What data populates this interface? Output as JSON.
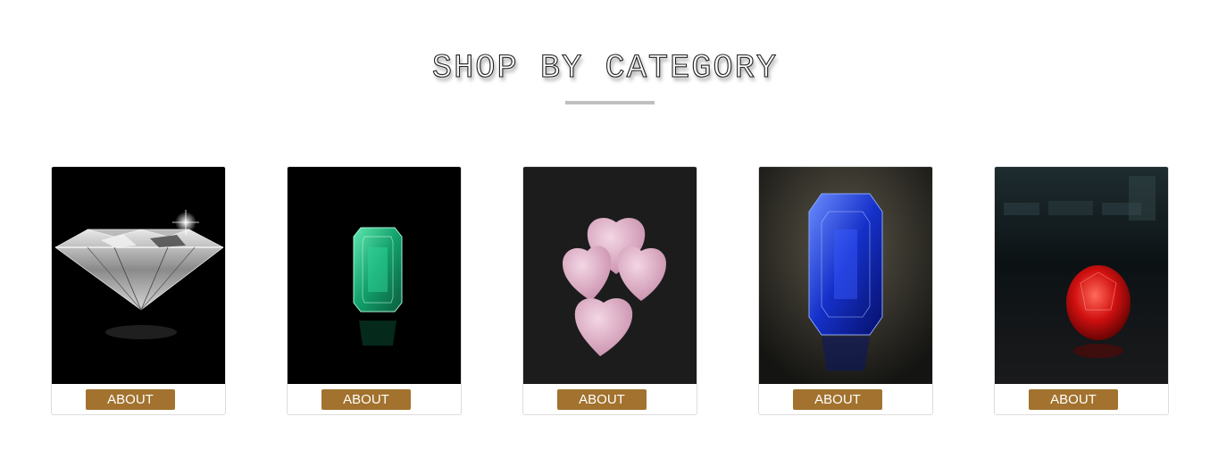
{
  "section": {
    "title": "SHOP BY CATEGORY"
  },
  "categories": [
    {
      "image_icon": "diamond-icon",
      "button_label": "ABOUT"
    },
    {
      "image_icon": "emerald-icon",
      "button_label": "ABOUT"
    },
    {
      "image_icon": "rose-quartz-hearts-icon",
      "button_label": "ABOUT"
    },
    {
      "image_icon": "blue-sapphire-icon",
      "button_label": "ABOUT"
    },
    {
      "image_icon": "ruby-icon",
      "button_label": "ABOUT"
    }
  ],
  "colors": {
    "button_bg": "#a2722e",
    "underline": "#c0c0c0",
    "card_border": "#dddddd"
  }
}
